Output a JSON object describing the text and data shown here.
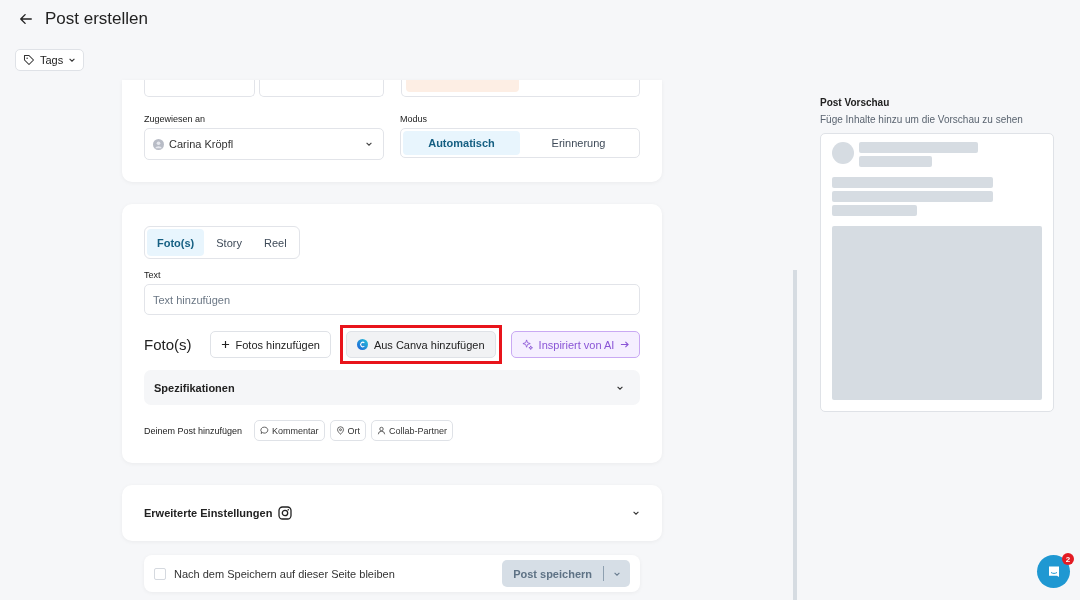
{
  "page": {
    "title": "Post erstellen"
  },
  "tags_button": {
    "label": "Tags"
  },
  "assignment": {
    "assignee_label": "Zugewiesen an",
    "assignee": "Carina Kröpfl",
    "mode_label": "Modus",
    "modes": [
      {
        "label": "Automatisch",
        "selected": true
      },
      {
        "label": "Erinnerung",
        "selected": false
      }
    ]
  },
  "post": {
    "types": [
      {
        "label": "Foto(s)",
        "selected": true
      },
      {
        "label": "Story",
        "selected": false
      },
      {
        "label": "Reel",
        "selected": false
      }
    ],
    "text_label": "Text",
    "text_placeholder": "Text hinzufügen",
    "photos_label": "Foto(s)",
    "photo_buttons": [
      {
        "kind": "add",
        "label": "Fotos hinzufügen",
        "highlighted": false
      },
      {
        "kind": "canva",
        "label": "Aus Canva hinzufügen",
        "highlighted": true
      },
      {
        "kind": "ai",
        "label": "Inspiriert von AI",
        "highlighted": false
      }
    ],
    "specs": {
      "label": "Spezifikationen",
      "expanded": false
    },
    "add_label": "Deinem Post hinzufügen",
    "add_chips": [
      {
        "kind": "comment",
        "label": "Kommentar"
      },
      {
        "kind": "location",
        "label": "Ort"
      },
      {
        "kind": "person",
        "label": "Collab-Partner"
      }
    ]
  },
  "advanced": {
    "label": "Erweiterte Einstellungen",
    "expanded": false
  },
  "save_bar": {
    "stay_label": "Nach dem Speichern auf dieser Seite bleiben",
    "stay_checked": false,
    "save_label": "Post speichern",
    "disabled": true
  },
  "preview": {
    "title": "Post Vorschau",
    "hint": "Füge Inhalte hinzu um die Vorschau zu sehen"
  },
  "chat": {
    "badge": "2"
  }
}
